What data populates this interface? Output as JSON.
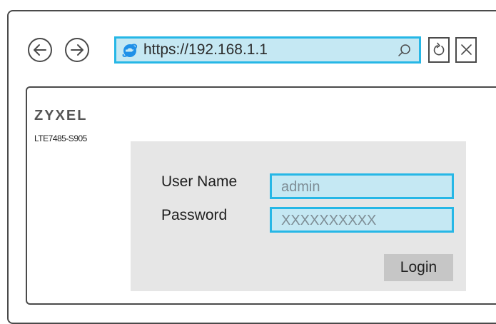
{
  "browser": {
    "url": "https://192.168.1.1"
  },
  "device": {
    "brand": "ZYXEL",
    "model": "LTE7485-S905"
  },
  "login": {
    "username_label": "User Name",
    "username_value": "admin",
    "password_label": "Password",
    "password_value": "XXXXXXXXXX",
    "login_button": "Login"
  },
  "colors": {
    "accent_border": "#26b7e6",
    "input_fill": "#c5e8f3",
    "panel_bg": "#e6e6e6",
    "button_bg": "#c6c6c6",
    "ie_icon": "#1e90e8"
  },
  "icons": {
    "back": "arrow-left-icon",
    "forward": "arrow-right-icon",
    "browser": "internet-explorer-icon",
    "search": "search-icon",
    "refresh": "refresh-icon",
    "close": "close-icon"
  }
}
